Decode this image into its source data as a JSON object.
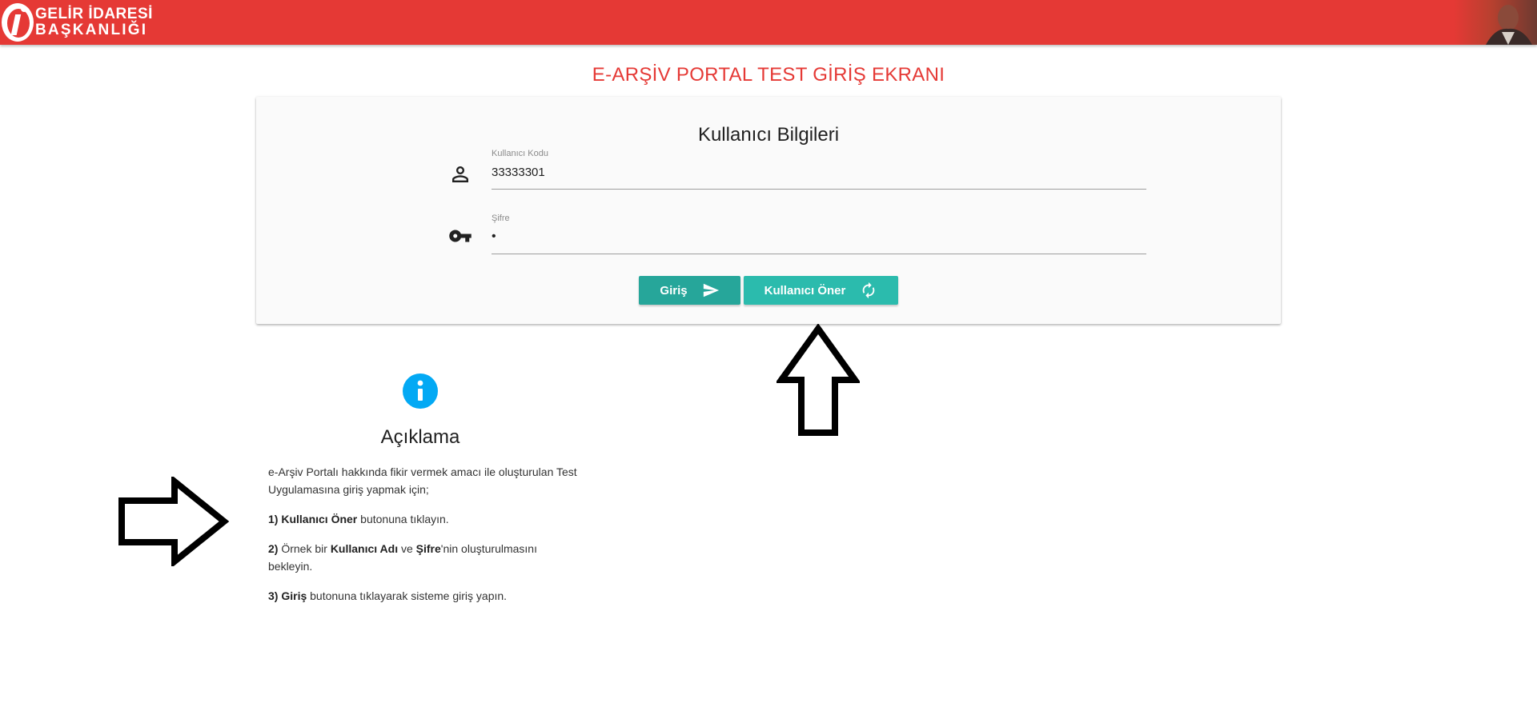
{
  "header": {
    "logo_line1": "GELİR İDARESİ",
    "logo_line2": "BAŞKANLIĞI",
    "brand_color": "#e53935"
  },
  "page_title": "E-ARŞİV PORTAL TEST GİRİŞ EKRANI",
  "login_card": {
    "title": "Kullanıcı Bilgileri",
    "username": {
      "label": "Kullanıcı Kodu",
      "value": "33333301",
      "icon": "person-icon"
    },
    "password": {
      "label": "Şifre",
      "value": "•",
      "icon": "key-icon"
    },
    "buttons": {
      "login_label": "Giriş",
      "login_icon": "send-icon",
      "suggest_label": "Kullanıcı Öner",
      "suggest_icon": "refresh-icon",
      "login_color": "#26a69a",
      "suggest_color": "#2bbbad"
    }
  },
  "info": {
    "icon": "info-icon",
    "icon_color": "#03a9f4",
    "title": "Açıklama",
    "intro": "e-Arşiv Portalı hakkında fikir vermek amacı ile oluşturulan Test Uygulamasına giriş yapmak için;",
    "step1": {
      "num": "1)",
      "bold": "Kullanıcı Öner",
      "text": " butonuna tıklayın."
    },
    "step2": {
      "num": "2)",
      "pre": " Örnek bir ",
      "bold1": "Kullanıcı Adı",
      "mid": " ve ",
      "bold2": "Şifre",
      "post": "'nin oluşturulmasını bekleyin."
    },
    "step3": {
      "num": "3)",
      "bold": "Giriş",
      "text": " butonuna tıklayarak sisteme giriş yapın."
    }
  }
}
